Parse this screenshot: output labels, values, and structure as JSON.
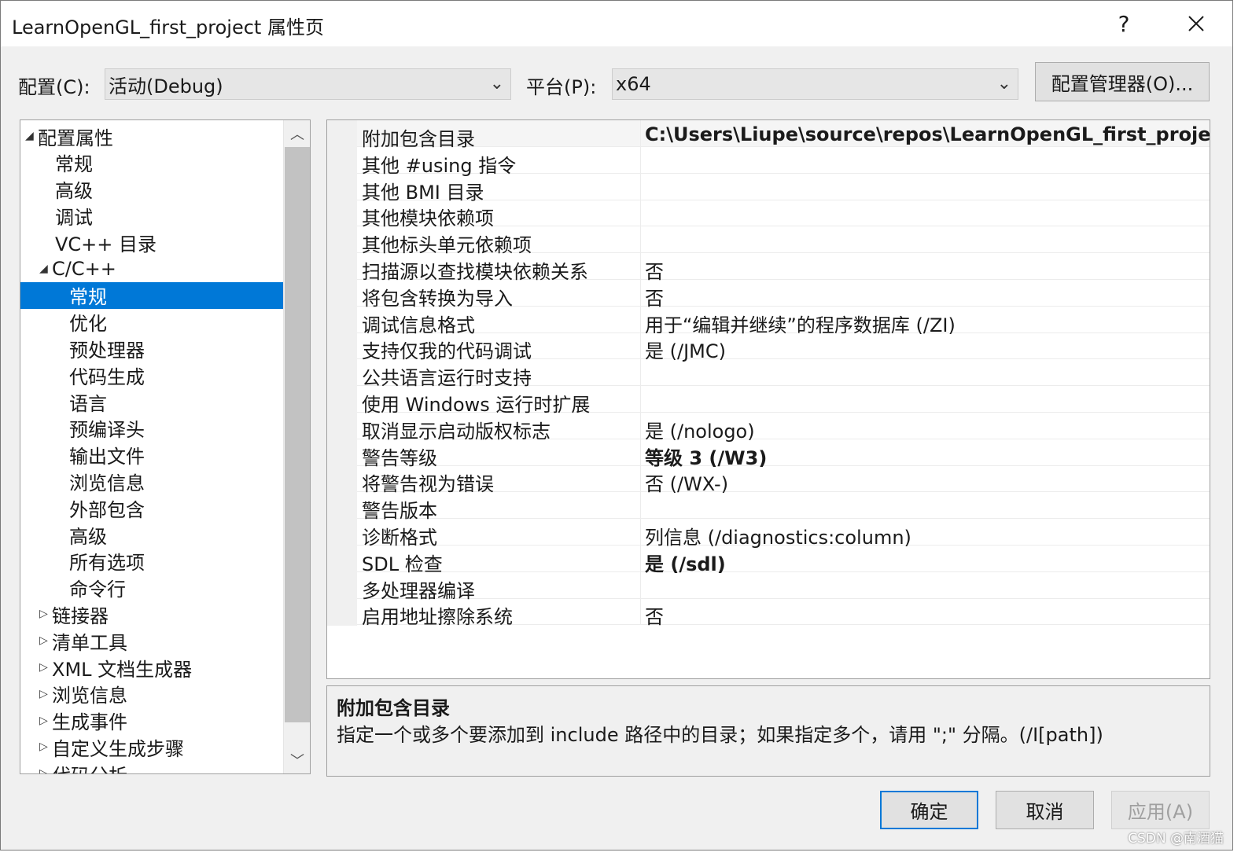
{
  "window": {
    "title": "LearnOpenGL_first_project 属性页",
    "help": "?",
    "close": "✕"
  },
  "config": {
    "config_label": "配置(C):",
    "config_value": "活动(Debug)",
    "platform_label": "平台(P):",
    "platform_value": "x64",
    "manager_button": "配置管理器(O)..."
  },
  "tree": {
    "items": [
      {
        "label": "配置属性",
        "arrow": "◢"
      },
      {
        "label": "常规",
        "arrow": ""
      },
      {
        "label": "高级",
        "arrow": ""
      },
      {
        "label": "调试",
        "arrow": ""
      },
      {
        "label": "VC++ 目录",
        "arrow": ""
      },
      {
        "label": "C/C++",
        "arrow": "◢"
      },
      {
        "label": "常规",
        "arrow": ""
      },
      {
        "label": "优化",
        "arrow": ""
      },
      {
        "label": "预处理器",
        "arrow": ""
      },
      {
        "label": "代码生成",
        "arrow": ""
      },
      {
        "label": "语言",
        "arrow": ""
      },
      {
        "label": "预编译头",
        "arrow": ""
      },
      {
        "label": "输出文件",
        "arrow": ""
      },
      {
        "label": "浏览信息",
        "arrow": ""
      },
      {
        "label": "外部包含",
        "arrow": ""
      },
      {
        "label": "高级",
        "arrow": ""
      },
      {
        "label": "所有选项",
        "arrow": ""
      },
      {
        "label": "命令行",
        "arrow": ""
      },
      {
        "label": "链接器",
        "arrow": "▷"
      },
      {
        "label": "清单工具",
        "arrow": "▷"
      },
      {
        "label": "XML 文档生成器",
        "arrow": "▷"
      },
      {
        "label": "浏览信息",
        "arrow": "▷"
      },
      {
        "label": "生成事件",
        "arrow": "▷"
      },
      {
        "label": "自定义生成步骤",
        "arrow": "▷"
      },
      {
        "label": "代码分析",
        "arrow": "▷"
      }
    ],
    "scroll_up": "︿",
    "scroll_down": "﹀"
  },
  "properties": [
    {
      "name": "附加包含目录",
      "value": "C:\\Users\\Liupe\\source\\repos\\LearnOpenGL_first_project\\Lea",
      "bold": true
    },
    {
      "name": "其他 #using 指令",
      "value": "",
      "bold": false
    },
    {
      "name": "其他 BMI 目录",
      "value": "",
      "bold": false
    },
    {
      "name": "其他模块依赖项",
      "value": "",
      "bold": false
    },
    {
      "name": "其他标头单元依赖项",
      "value": "",
      "bold": false
    },
    {
      "name": "扫描源以查找模块依赖关系",
      "value": "否",
      "bold": false
    },
    {
      "name": "将包含转换为导入",
      "value": "否",
      "bold": false
    },
    {
      "name": "调试信息格式",
      "value": "用于“编辑并继续”的程序数据库 (/ZI)",
      "bold": false
    },
    {
      "name": "支持仅我的代码调试",
      "value": "是 (/JMC)",
      "bold": false
    },
    {
      "name": "公共语言运行时支持",
      "value": "",
      "bold": false
    },
    {
      "name": "使用 Windows 运行时扩展",
      "value": "",
      "bold": false
    },
    {
      "name": "取消显示启动版权标志",
      "value": "是 (/nologo)",
      "bold": false
    },
    {
      "name": "警告等级",
      "value": "等级 3 (/W3)",
      "bold": true
    },
    {
      "name": "将警告视为错误",
      "value": "否 (/WX-)",
      "bold": false
    },
    {
      "name": "警告版本",
      "value": "",
      "bold": false
    },
    {
      "name": "诊断格式",
      "value": "列信息 (/diagnostics:column)",
      "bold": false
    },
    {
      "name": "SDL 检查",
      "value": "是 (/sdl)",
      "bold": true
    },
    {
      "name": "多处理器编译",
      "value": "",
      "bold": false
    },
    {
      "name": "启用地址擦除系统",
      "value": "否",
      "bold": false
    }
  ],
  "description": {
    "title": "附加包含目录",
    "text": "指定一个或多个要添加到 include 路径中的目录；如果指定多个，请用 \";\" 分隔。(/I[path])"
  },
  "buttons": {
    "ok": "确定",
    "cancel": "取消",
    "apply": "应用(A)"
  },
  "watermark": "CSDN @南酒猫"
}
